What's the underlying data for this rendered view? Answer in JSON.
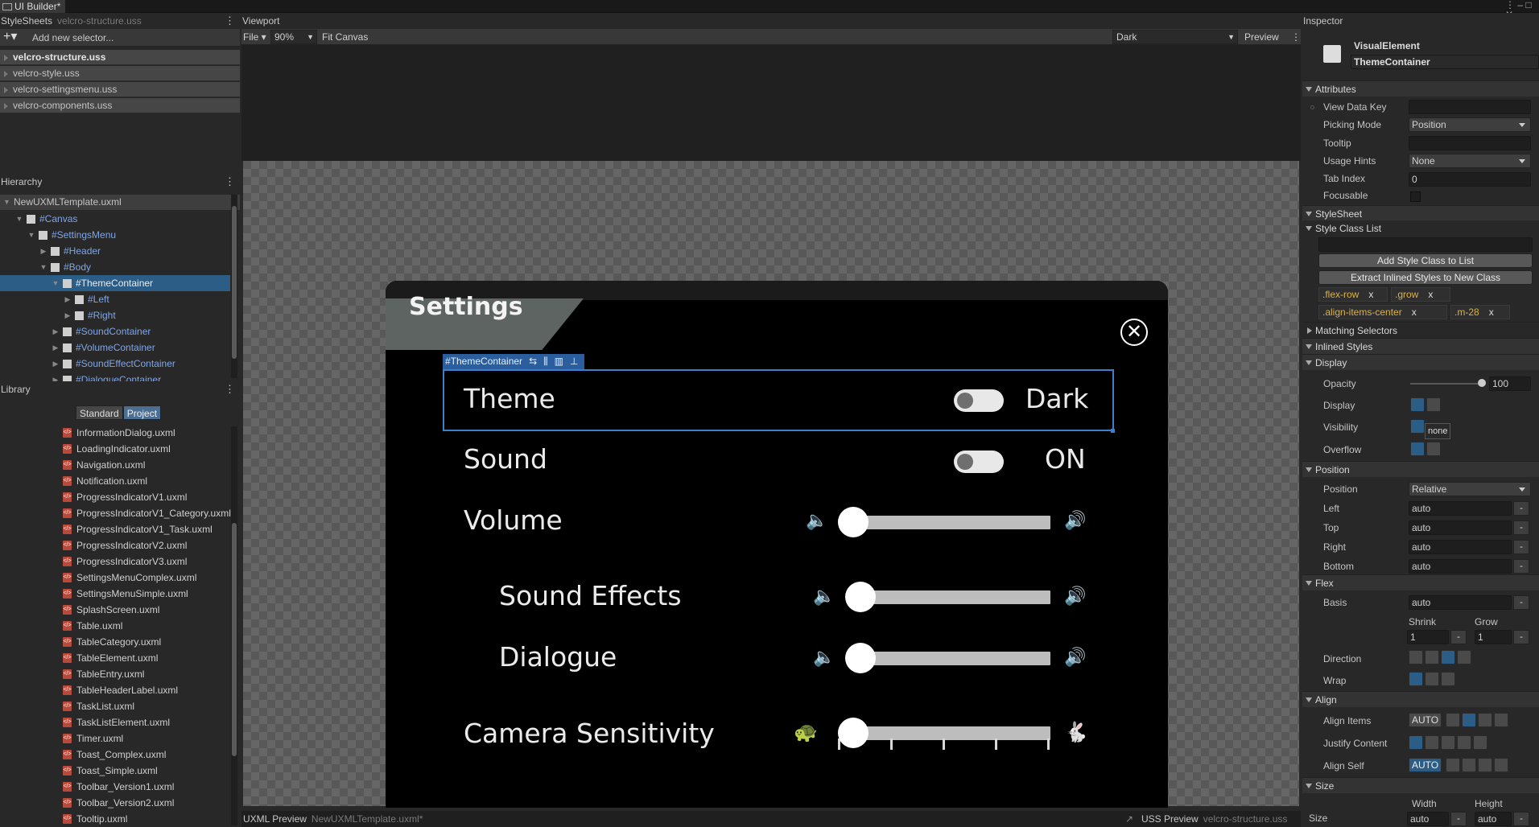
{
  "window": {
    "tab_title": "UI Builder*",
    "controls": "⋮ – □ ✕"
  },
  "stylesheets": {
    "header": "StyleSheets",
    "current_file": "velcro-structure.uss",
    "add_placeholder": "Add new selector...",
    "files": [
      "velcro-structure.uss",
      "velcro-style.uss",
      "velcro-settingsmenu.uss",
      "velcro-components.uss"
    ]
  },
  "hierarchy": {
    "header": "Hierarchy",
    "root": "NewUXMLTemplate.uxml",
    "items": [
      {
        "label": "#Canvas",
        "depth": 1,
        "expanded": true,
        "selected": false
      },
      {
        "label": "#SettingsMenu",
        "depth": 2,
        "expanded": true,
        "selected": false
      },
      {
        "label": "#Header",
        "depth": 3,
        "expanded": false,
        "selected": false
      },
      {
        "label": "#Body",
        "depth": 3,
        "expanded": true,
        "selected": false
      },
      {
        "label": "#ThemeContainer",
        "depth": 4,
        "expanded": true,
        "selected": true
      },
      {
        "label": "#Left",
        "depth": 5,
        "expanded": false,
        "selected": false
      },
      {
        "label": "#Right",
        "depth": 5,
        "expanded": false,
        "selected": false
      },
      {
        "label": "#SoundContainer",
        "depth": 4,
        "expanded": false,
        "selected": false
      },
      {
        "label": "#VolumeContainer",
        "depth": 4,
        "expanded": false,
        "selected": false
      },
      {
        "label": "#SoundEffectContainer",
        "depth": 4,
        "expanded": false,
        "selected": false
      },
      {
        "label": "#DialogueContainer",
        "depth": 4,
        "expanded": false,
        "selected": false
      }
    ]
  },
  "library": {
    "header": "Library",
    "tabs": [
      "Standard",
      "Project"
    ],
    "active_tab": "Project",
    "files": [
      "InformationDialog.uxml",
      "LoadingIndicator.uxml",
      "Navigation.uxml",
      "Notification.uxml",
      "ProgressIndicatorV1.uxml",
      "ProgressIndicatorV1_Category.uxml",
      "ProgressIndicatorV1_Task.uxml",
      "ProgressIndicatorV2.uxml",
      "ProgressIndicatorV3.uxml",
      "SettingsMenuComplex.uxml",
      "SettingsMenuSimple.uxml",
      "SplashScreen.uxml",
      "Table.uxml",
      "TableCategory.uxml",
      "TableElement.uxml",
      "TableEntry.uxml",
      "TableHeaderLabel.uxml",
      "TaskList.uxml",
      "TaskListElement.uxml",
      "Timer.uxml",
      "Toast_Complex.uxml",
      "Toast_Simple.uxml",
      "Toolbar_Version1.uxml",
      "Toolbar_Version2.uxml",
      "Tooltip.uxml"
    ]
  },
  "viewport": {
    "header": "Viewport",
    "file_menu": "File",
    "zoom": "90%",
    "fit_canvas": "Fit Canvas",
    "theme": "Dark",
    "preview": "Preview"
  },
  "settings_menu": {
    "title": "Settings",
    "close_glyph": "✕",
    "selection_label": "#ThemeContainer",
    "rows": {
      "theme": {
        "label": "Theme",
        "value": "Dark"
      },
      "sound": {
        "label": "Sound",
        "value": "ON"
      },
      "volume": {
        "label": "Volume",
        "level": 0
      },
      "sound_effects": {
        "label": "Sound Effects",
        "level": 0
      },
      "dialogue": {
        "label": "Dialogue",
        "level": 0
      },
      "camera": {
        "label": "Camera Sensitivity",
        "level": 0
      }
    }
  },
  "bottom": {
    "uxml_preview": "UXML Preview",
    "uxml_file": "NewUXMLTemplate.uxml*",
    "uss_preview": "USS Preview",
    "uss_file": "velcro-structure.uss"
  },
  "inspector": {
    "header": "Inspector",
    "element_type": "VisualElement",
    "element_name": "ThemeContainer",
    "sections": {
      "attributes": "Attributes",
      "stylesheet": "StyleSheet",
      "style_class_list": "Style Class List",
      "matching_selectors": "Matching Selectors",
      "inlined_styles": "Inlined Styles",
      "display": "Display",
      "position": "Position",
      "flex": "Flex",
      "align": "Align",
      "size": "Size"
    },
    "attributes": {
      "view_data_key": {
        "label": "View Data Key",
        "value": ""
      },
      "picking_mode": {
        "label": "Picking Mode",
        "value": "Position"
      },
      "tooltip": {
        "label": "Tooltip",
        "value": ""
      },
      "usage_hints": {
        "label": "Usage Hints",
        "value": "None"
      },
      "tab_index": {
        "label": "Tab Index",
        "value": "0"
      },
      "focusable": {
        "label": "Focusable"
      }
    },
    "buttons": {
      "add_class": "Add Style Class to List",
      "extract": "Extract Inlined Styles to New Class"
    },
    "classes": [
      ".flex-row",
      ".grow",
      ".align-items-center",
      ".m-28"
    ],
    "remove_glyph": "x",
    "display": {
      "opacity": {
        "label": "Opacity",
        "value": "100"
      },
      "display": {
        "label": "Display"
      },
      "visibility": {
        "label": "Visibility",
        "tooltip": "none"
      },
      "overflow": {
        "label": "Overflow"
      }
    },
    "position": {
      "position": {
        "label": "Position",
        "value": "Relative"
      },
      "left": {
        "label": "Left",
        "value": "auto"
      },
      "top": {
        "label": "Top",
        "value": "auto"
      },
      "right": {
        "label": "Right",
        "value": "auto"
      },
      "bottom": {
        "label": "Bottom",
        "value": "auto"
      }
    },
    "flex": {
      "basis": {
        "label": "Basis",
        "value": "auto"
      },
      "shrink": {
        "label": "Shrink",
        "value": "1"
      },
      "grow": {
        "label": "Grow",
        "value": "1"
      },
      "direction": {
        "label": "Direction"
      },
      "wrap": {
        "label": "Wrap"
      }
    },
    "align": {
      "align_items": {
        "label": "Align Items",
        "auto": "AUTO"
      },
      "justify_content": {
        "label": "Justify Content"
      },
      "align_self": {
        "label": "Align Self",
        "auto": "AUTO"
      }
    },
    "size": {
      "label": "Size",
      "width_label": "Width",
      "height_label": "Height",
      "width": "auto",
      "height": "auto"
    },
    "minus_glyph": "-",
    "colors": {
      "accent": "#2c5d87",
      "class_tag": "#d9b14a"
    }
  }
}
